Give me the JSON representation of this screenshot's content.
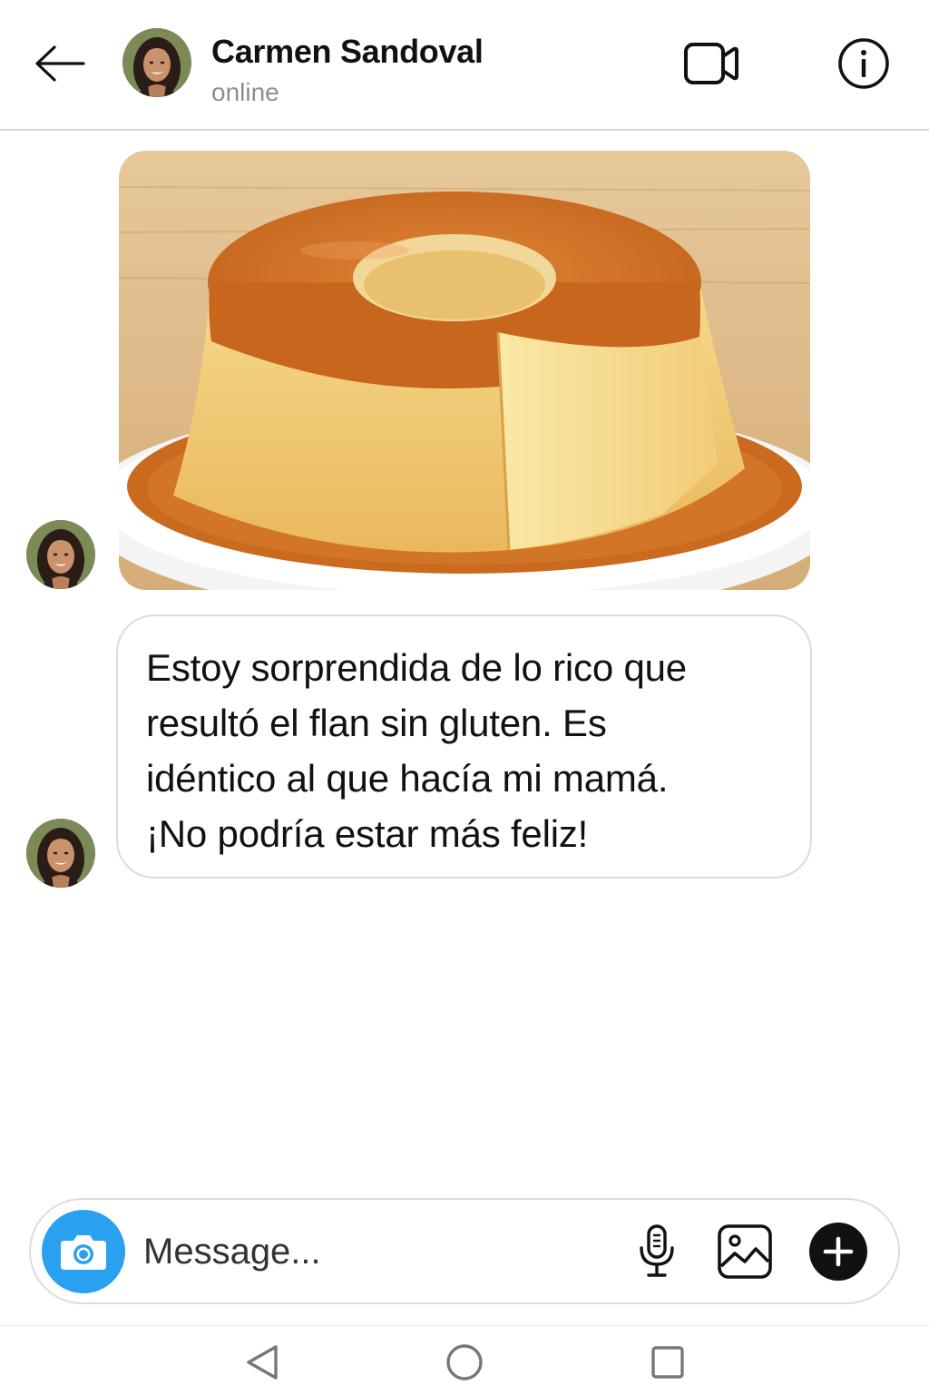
{
  "header": {
    "contact_name": "Carmen Sandoval",
    "status": "online",
    "icons": {
      "back": "arrow-left-icon",
      "video": "video-call-icon",
      "info": "info-icon"
    }
  },
  "messages": [
    {
      "type": "photo",
      "sender": "Carmen Sandoval",
      "content": "photo of caramel flan on a white plate"
    },
    {
      "type": "text",
      "sender": "Carmen Sandoval",
      "lines": [
        "Estoy sorprendida de lo rico que",
        "resultó el flan sin gluten. Es",
        "idéntico al que hacía mi mamá.",
        "¡No podría estar más feliz!"
      ]
    }
  ],
  "composer": {
    "placeholder": "Message...",
    "value": "",
    "icons": {
      "camera": "camera-icon",
      "mic": "microphone-icon",
      "gallery": "image-gallery-icon",
      "add": "plus-icon"
    }
  },
  "nav_bar": {
    "icons": [
      "nav-back-icon",
      "nav-home-icon",
      "nav-recents-icon"
    ]
  },
  "colors": {
    "camera_button": "#2aa1f0",
    "divider": "#d9d9d9",
    "status_text": "#8e8e8e",
    "plus_button": "#111111"
  }
}
